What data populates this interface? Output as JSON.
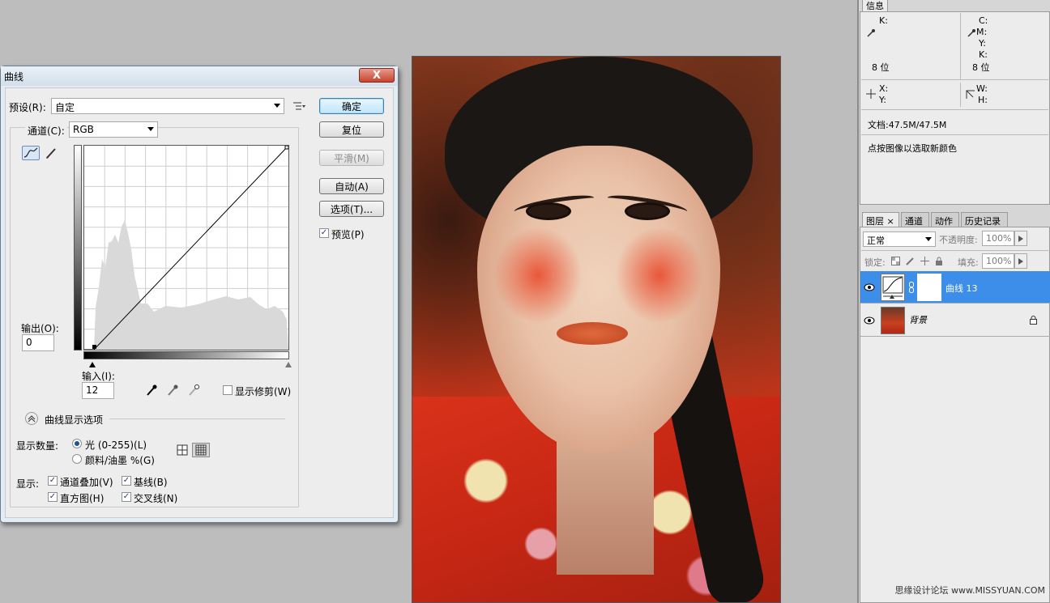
{
  "dialog": {
    "title": "曲线",
    "close_label": "X",
    "preset_label": "预设(R):",
    "preset_value": "自定",
    "channel_label": "通道(C):",
    "channel_value": "RGB",
    "output_label": "输出(O):",
    "output_value": "0",
    "input_label": "输入(I):",
    "input_value": "12",
    "show_clipping_label": "显示修剪(W)",
    "curve_options_label": "曲线显示选项",
    "show_amount_label": "显示数量:",
    "radio_light_label": "光 (0-255)(L)",
    "radio_pigment_label": "颜料/油墨 %(G)",
    "show_label": "显示:",
    "cb_channel_overlay": "通道叠加(V)",
    "cb_baseline": "基线(B)",
    "cb_histogram": "直方图(H)",
    "cb_intersection": "交叉线(N)",
    "buttons": {
      "ok": "确定",
      "reset": "复位",
      "smooth": "平滑(M)",
      "auto": "自动(A)",
      "options": "选项(T)..."
    },
    "preview_label": "预览(P)"
  },
  "info_panel": {
    "tab": "信息",
    "k_label": "K:",
    "c_label": "C:",
    "m_label": "M:",
    "y_label": "Y:",
    "k2_label": "K:",
    "bit_left": "8 位",
    "bit_right": "8 位",
    "x_label": "X:",
    "y2_label": "Y:",
    "w_label": "W:",
    "h_label": "H:",
    "doc_label": "文档:47.5M/47.5M",
    "hint": "点按图像以选取新颜色"
  },
  "layers_panel": {
    "tabs": [
      "图层",
      "通道",
      "动作",
      "历史记录"
    ],
    "blend_mode": "正常",
    "opacity_label": "不透明度:",
    "opacity_value": "100%",
    "lock_label": "锁定:",
    "fill_label": "填充:",
    "fill_value": "100%",
    "layers": [
      {
        "name": "曲线 13",
        "selected": true
      },
      {
        "name": "背景",
        "selected": false
      }
    ]
  },
  "watermark": "思缘设计论坛 www.MISSYUAN.COM",
  "colors": {
    "selection": "#3d8ee8",
    "canvas_bg": "#bdbdbd"
  }
}
